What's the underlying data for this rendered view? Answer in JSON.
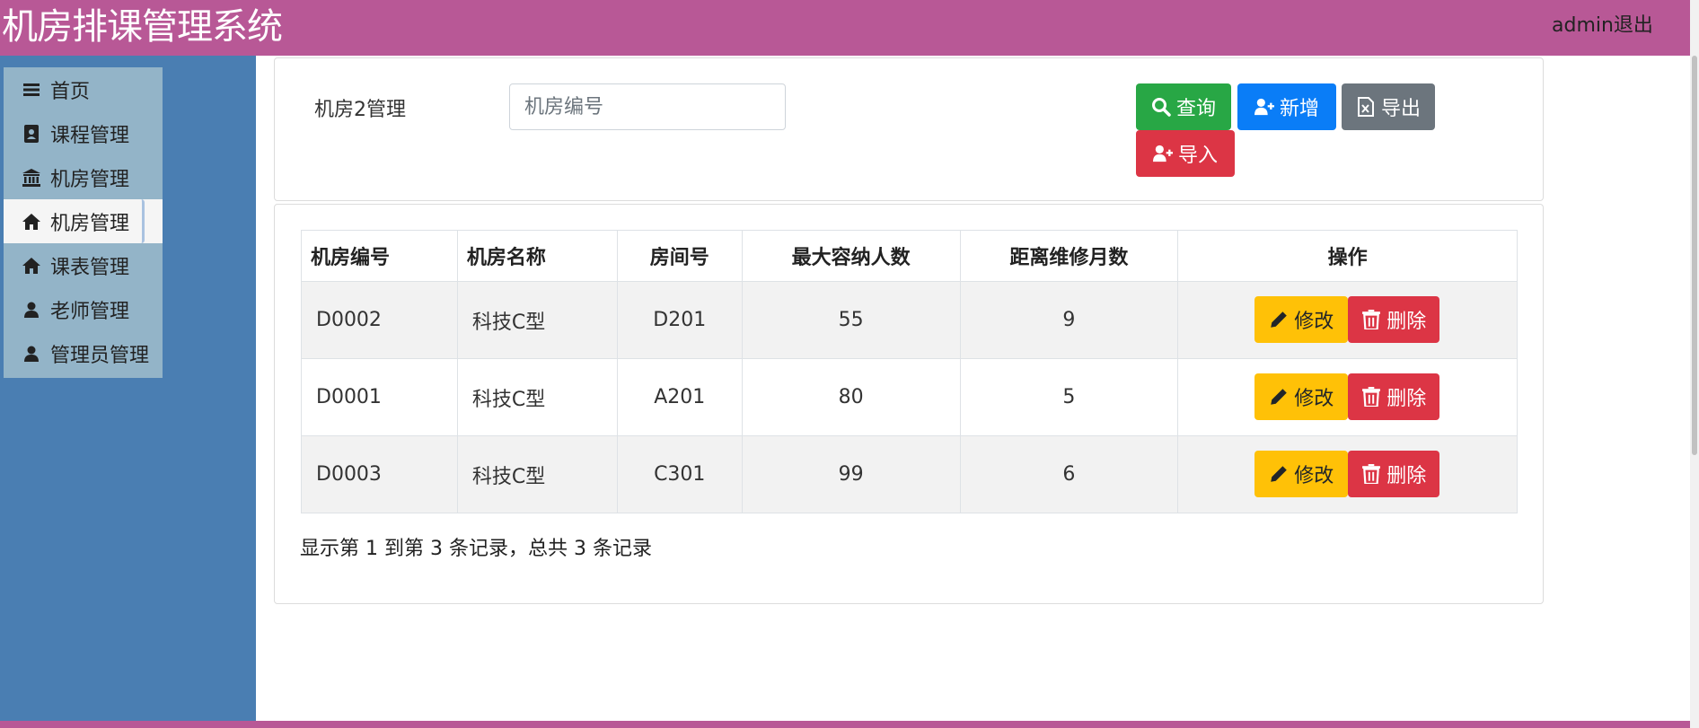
{
  "header": {
    "title": "机房排课管理系统",
    "logout_label": "admin退出"
  },
  "sidebar": {
    "items": [
      {
        "label": "首页",
        "icon": "menu-bars-icon"
      },
      {
        "label": "课程管理",
        "icon": "address-book-icon"
      },
      {
        "label": "机房管理",
        "icon": "institution-icon"
      },
      {
        "label": "机房管理",
        "icon": "home-icon",
        "active": true
      },
      {
        "label": "课表管理",
        "icon": "home-icon"
      },
      {
        "label": "老师管理",
        "icon": "user-icon"
      },
      {
        "label": "管理员管理",
        "icon": "user-icon"
      }
    ]
  },
  "search": {
    "label": "机房2管理",
    "placeholder": "机房编号",
    "value": ""
  },
  "toolbar": {
    "query_label": "查询",
    "add_label": "新增",
    "export_label": "导出",
    "import_label": "导入"
  },
  "table": {
    "columns": [
      "机房编号",
      "机房名称",
      "房间号",
      "最大容纳人数",
      "距离维修月数",
      "操作"
    ],
    "rows": [
      {
        "code": "D0002",
        "name": "科技C型",
        "room": "D201",
        "capacity": "55",
        "months": "9"
      },
      {
        "code": "D0001",
        "name": "科技C型",
        "room": "A201",
        "capacity": "80",
        "months": "5"
      },
      {
        "code": "D0003",
        "name": "科技C型",
        "room": "C301",
        "capacity": "99",
        "months": "6"
      }
    ],
    "edit_label": "修改",
    "delete_label": "删除"
  },
  "pagination": {
    "info": "显示第 1 到第 3 条记录，总共 3 条记录"
  },
  "colors": {
    "header_bg": "#b85896",
    "sidebar_bg": "#4a7eb2",
    "menu_bg": "#93b4c8",
    "query": "#28a745",
    "add": "#0a7df7",
    "export": "#6c757d",
    "import": "#dc3545",
    "edit": "#ffc107",
    "delete": "#dc3545"
  }
}
